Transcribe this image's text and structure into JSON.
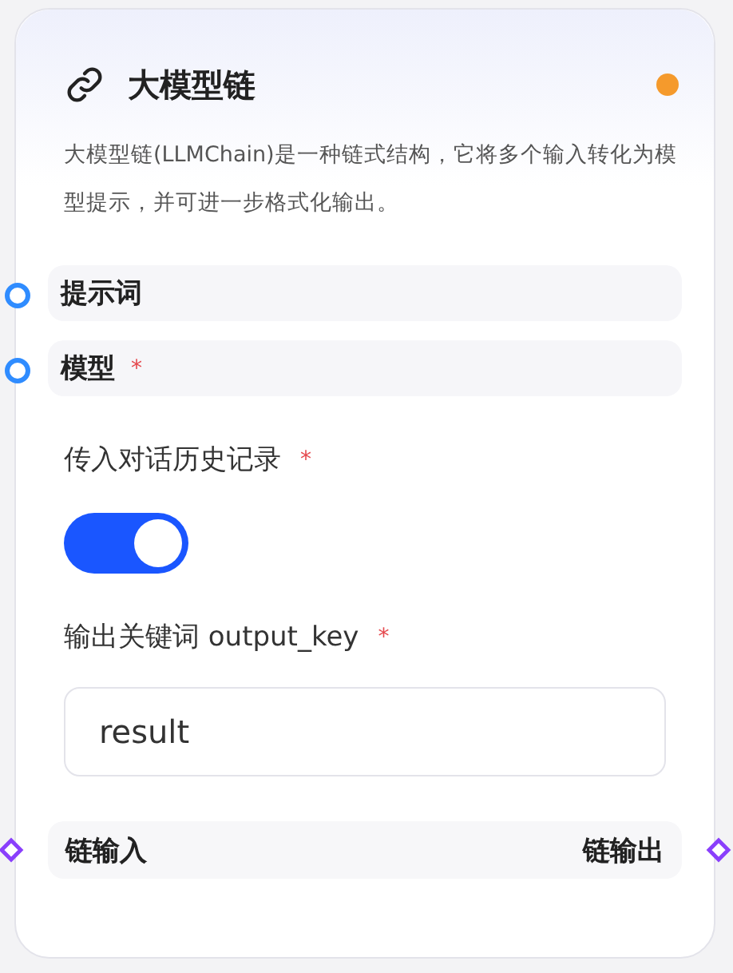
{
  "node": {
    "title": "大模型链",
    "description": "大模型链(LLMChain)是一种链式结构，它将多个输入转化为模型提示，并可进一步格式化输出。"
  },
  "required_mark": "*",
  "inputs": [
    {
      "label": "提示词",
      "required": false
    },
    {
      "label": "模型",
      "required": true
    }
  ],
  "fields": [
    {
      "kind": "toggle",
      "label": "传入对话历史记录",
      "required": true,
      "on": true
    },
    {
      "kind": "text",
      "label": "输出关键词 output_key",
      "required": true,
      "value": "result"
    }
  ],
  "chain": {
    "input": "链输入",
    "output": "链输出"
  }
}
